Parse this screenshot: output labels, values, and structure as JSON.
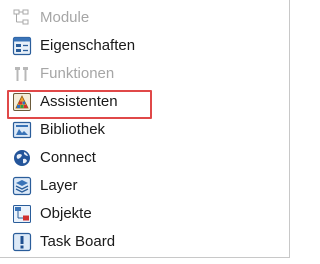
{
  "menu": {
    "items": [
      {
        "label": "Module",
        "icon": "module-icon",
        "enabled": false
      },
      {
        "label": "Eigenschaften",
        "icon": "properties-icon",
        "enabled": true
      },
      {
        "label": "Funktionen",
        "icon": "functions-icon",
        "enabled": false
      },
      {
        "label": "Assistenten",
        "icon": "assistants-icon",
        "enabled": true,
        "highlighted": true
      },
      {
        "label": "Bibliothek",
        "icon": "library-icon",
        "enabled": true
      },
      {
        "label": "Connect",
        "icon": "connect-icon",
        "enabled": true
      },
      {
        "label": "Layer",
        "icon": "layer-icon",
        "enabled": true
      },
      {
        "label": "Objekte",
        "icon": "objects-icon",
        "enabled": true
      },
      {
        "label": "Task Board",
        "icon": "task-board-icon",
        "enabled": true
      }
    ]
  },
  "colors": {
    "text": "#1a1a1a",
    "disabled_text": "#a6a6a6",
    "highlight_border": "#e04848",
    "panel_border": "#c8c8c8"
  }
}
